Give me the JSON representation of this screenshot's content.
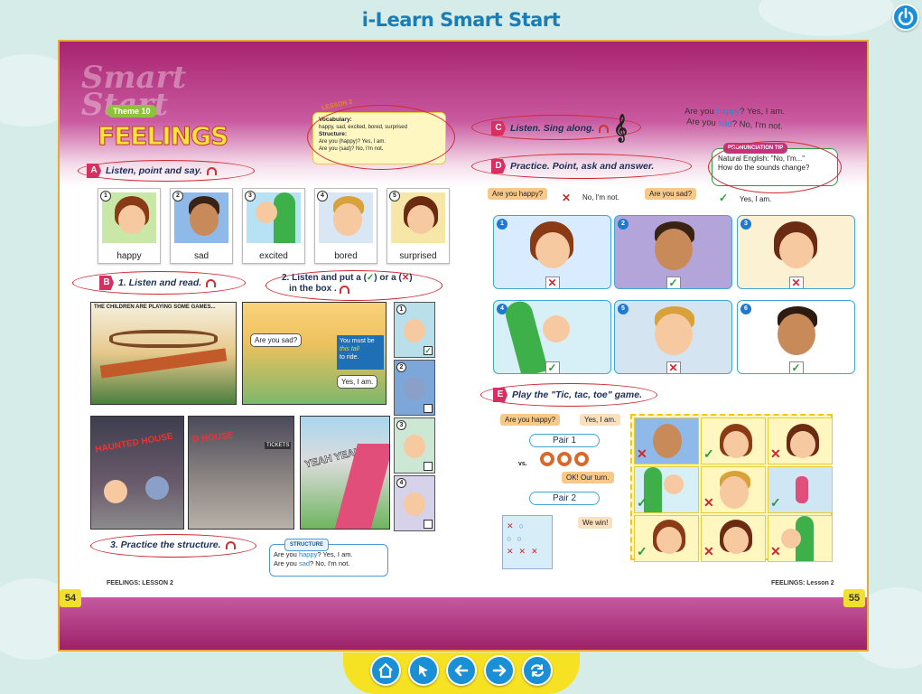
{
  "app": {
    "title": "i-Learn Smart Start"
  },
  "left_page": {
    "theme_tag": "Theme 10",
    "title": "FEELINGS",
    "lesson_tag": "LESSON 2",
    "vocab": {
      "heading": "Vocabulary:",
      "words": "happy, sad, excited, bored, surprised",
      "structure_heading": "Structure:",
      "q": "Are you (happy)? Yes, I am.",
      "a": "Are you (sad)? No, I'm not."
    },
    "section_a": {
      "letter": "A",
      "text": "Listen, point and say."
    },
    "cards": [
      {
        "num": "1",
        "label": "happy"
      },
      {
        "num": "2",
        "label": "sad"
      },
      {
        "num": "3",
        "label": "excited"
      },
      {
        "num": "4",
        "label": "bored"
      },
      {
        "num": "5",
        "label": "surprised"
      }
    ],
    "section_b": {
      "letter": "B",
      "text": "1. Listen and read.",
      "text2": "2. Listen and put a (",
      "text2b": ") or a (",
      "text2c": ")",
      "text2d": "in the box ."
    },
    "story": {
      "caption": "THE CHILDREN ARE PLAYING SOME GAMES...",
      "bubble1": "Are you sad?",
      "bubble2": "You must be",
      "bubble2b": "this tall",
      "bubble2c": "to ride.",
      "bubble3": "Yes, I am.",
      "sign1": "HAUNTED HOUSE",
      "sign2": "D HOUSE",
      "sign3": "TICKETS",
      "yeah": "YEAH YEAH"
    },
    "strip_numbers": [
      "1",
      "2",
      "3",
      "4"
    ],
    "section_b3": {
      "text": "3. Practice the structure."
    },
    "structure_box": {
      "title": "STRUCTURE",
      "l1a": "Are you ",
      "l1b": "happy",
      "l1c": "?  Yes, I am.",
      "l2a": "Are you ",
      "l2b": "sad",
      "l2c": "?     No, I'm not."
    },
    "footer": "FEELINGS: LESSON 2",
    "page_number": "54"
  },
  "right_page": {
    "section_c": {
      "letter": "C",
      "text": "Listen. Sing along."
    },
    "song": {
      "l1a": "Are you ",
      "l1b": "happy",
      "l1c": "? Yes, I am.",
      "l2a": "Are you ",
      "l2b": "sad",
      "l2c": "? No, I'm not."
    },
    "section_d": {
      "letter": "D",
      "text": "Practice. Point, ask and answer."
    },
    "pronunciation": {
      "title": "PRONUNCIATION TIP",
      "l1": "Natural English: \"No, I'm...\"",
      "l2": "How do the sounds change?"
    },
    "d_dialog": {
      "q1": "Are you happy?",
      "a1": "No, I'm not.",
      "q2": "Are you sad?",
      "a2": "Yes, I am."
    },
    "grid": [
      {
        "num": "1",
        "mark": "✕"
      },
      {
        "num": "2",
        "mark": "✓"
      },
      {
        "num": "3",
        "mark": "✕"
      },
      {
        "num": "4",
        "mark": "✓"
      },
      {
        "num": "5",
        "mark": "✕"
      },
      {
        "num": "6",
        "mark": "✓"
      }
    ],
    "section_e": {
      "letter": "E",
      "text": "Play the \"Tic, tac, toe\" game."
    },
    "game": {
      "q": "Are you happy?",
      "a": "Yes, I am.",
      "pair1": "Pair 1",
      "vs": "vs.",
      "pair2": "Pair 2",
      "our_turn": "OK! Our turn.",
      "we_win": "We win!"
    },
    "ttt_marks": [
      "✕",
      "✓",
      "✕",
      "✓",
      "✕",
      "✓",
      "✓",
      "✕",
      "✕"
    ],
    "footer": "FEELINGS: Lesson 2",
    "page_number": "55"
  },
  "nav": [
    "home-icon",
    "cursor-icon",
    "prev-icon",
    "next-icon",
    "refresh-icon"
  ],
  "colors": {
    "brand": "#1b7db5",
    "magenta": "#a8236f",
    "badge": "#d72f62",
    "nav_yellow": "#f6e223"
  }
}
